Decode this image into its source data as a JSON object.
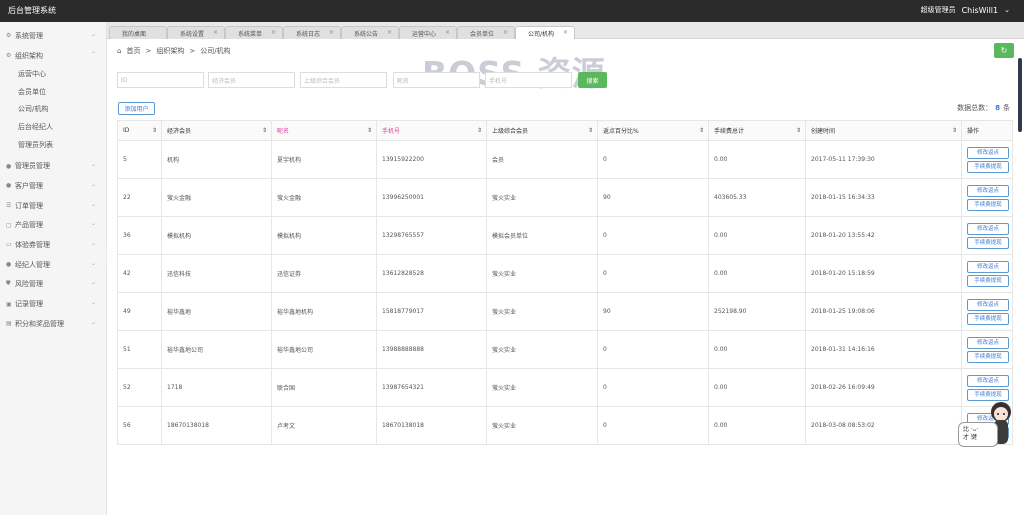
{
  "app": {
    "title": "后台管理系统"
  },
  "user": {
    "role": "超级管理员",
    "name": "ChisWill1"
  },
  "sidebar": {
    "menu_top": [
      {
        "label": "系统管理"
      },
      {
        "label": "组织架构"
      }
    ],
    "submenu": [
      {
        "label": "运营中心"
      },
      {
        "label": "会员单位"
      },
      {
        "label": "公司/机构"
      },
      {
        "label": "后台经纪人"
      },
      {
        "label": "管理员列表"
      }
    ],
    "menu_bottom": [
      {
        "label": "管理员管理"
      },
      {
        "label": "客户管理"
      },
      {
        "label": "订单管理"
      },
      {
        "label": "产品管理"
      },
      {
        "label": "体验券管理"
      },
      {
        "label": "经纪人管理"
      },
      {
        "label": "风险管理"
      },
      {
        "label": "记录管理"
      },
      {
        "label": "积分和奖品管理"
      }
    ]
  },
  "tabs": [
    {
      "label": "我的桌面"
    },
    {
      "label": "系统设置"
    },
    {
      "label": "系统菜单"
    },
    {
      "label": "系统日志"
    },
    {
      "label": "系统公告"
    },
    {
      "label": "运营中心"
    },
    {
      "label": "会员单位"
    },
    {
      "label": "公司/机构"
    }
  ],
  "breadcrumb": {
    "home": "首页",
    "sep": ">",
    "level1": "组织架构",
    "level2": "公司/机构"
  },
  "watermark": "BOSS 资源",
  "filters": {
    "id_placeholder": "ID",
    "member_placeholder": "经济会员",
    "parent_placeholder": "上级综合会员",
    "nickname_placeholder": "昵名",
    "phone_placeholder": "手机号",
    "search_label": "搜索"
  },
  "toolbar": {
    "create_label": "添加用户",
    "total_label": "数据总数：",
    "total_count": "8",
    "total_unit": "条"
  },
  "table": {
    "headers": [
      "ID",
      "经济会员",
      "昵名",
      "手机号",
      "上级综合会员",
      "返点百分比%",
      "手续费总计",
      "创建时间",
      "操作"
    ],
    "op_labels": {
      "edit": "修改返点",
      "withdraw": "手续费提现"
    },
    "rows": [
      {
        "id": "5",
        "member": "机构",
        "nickname": "夏宇机构",
        "phone": "13915922200",
        "parent": "会员",
        "rebate": "0",
        "fee": "0.00",
        "created": "2017-05-11 17:39:30"
      },
      {
        "id": "22",
        "member": "萤火金融",
        "nickname": "萤火金融",
        "phone": "13996250001",
        "parent": "萤火实业",
        "rebate": "90",
        "fee": "403605.33",
        "created": "2018-01-15 16:34:33"
      },
      {
        "id": "36",
        "member": "模拟机构",
        "nickname": "模拟机构",
        "phone": "13298765557",
        "parent": "模拟会员单位",
        "rebate": "0",
        "fee": "0.00",
        "created": "2018-01-20 13:55:42"
      },
      {
        "id": "42",
        "member": "迅信科技",
        "nickname": "迅信证券",
        "phone": "13612828528",
        "parent": "萤火实业",
        "rebate": "0",
        "fee": "0.00",
        "created": "2018-01-20 15:18:59"
      },
      {
        "id": "49",
        "member": "裕华鑫地",
        "nickname": "裕华鑫地机构",
        "phone": "15818779017",
        "parent": "萤火实业",
        "rebate": "90",
        "fee": "252198.90",
        "created": "2018-01-25 19:08:06"
      },
      {
        "id": "51",
        "member": "裕华鑫地公司",
        "nickname": "裕华鑫地公司",
        "phone": "13988888888",
        "parent": "萤火实业",
        "rebate": "0",
        "fee": "0.00",
        "created": "2018-01-31 14:16:16"
      },
      {
        "id": "52",
        "member": "1718",
        "nickname": "联合国",
        "phone": "13987654321",
        "parent": "萤火实业",
        "rebate": "0",
        "fee": "0.00",
        "created": "2018-02-26 16:09:49"
      },
      {
        "id": "56",
        "member": "18670138018",
        "nickname": "卢考文",
        "phone": "18670138018",
        "parent": "萤火实业",
        "rebate": "0",
        "fee": "0.00",
        "created": "2018-03-08 08:53:02"
      }
    ]
  },
  "mascot": {
    "line1": "比 ·ᴗ·",
    "line2": "才 键"
  },
  "colors": {
    "topbar": "#2b2b2b",
    "accent_green": "#5cb85c",
    "accent_blue": "#3a7bd5",
    "header_pink": "#e040a0"
  }
}
